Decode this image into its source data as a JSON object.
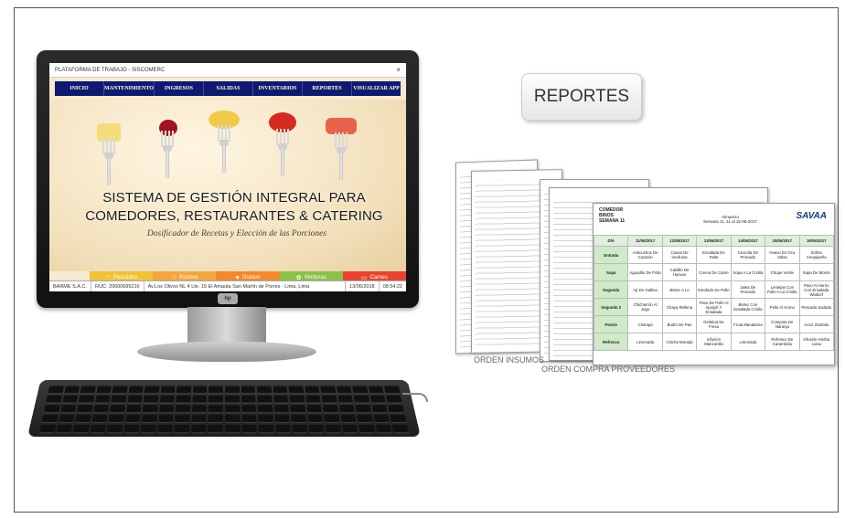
{
  "window": {
    "title": "PLATAFORMA DE TRABAJO - SISCOMERC",
    "close_glyph": "×"
  },
  "menu": [
    "INICIO",
    "MANTENIMIENTO",
    "INGRESOS",
    "SALIDAS",
    "INVENTARIOS",
    "REPORTES",
    "VISUALIZAR APP"
  ],
  "hero": {
    "title_line1": "SISTEMA DE GESTIÓN INTEGRAL PARA",
    "title_line2": "COMEDORES, RESTAURANTES & CATERING",
    "subtitle": "Dosificador de Recetas y Elección de las Porciones"
  },
  "categories": [
    {
      "label": "Pescados",
      "icon": "fish-icon",
      "glyph": "◠",
      "color": "#f0c13a"
    },
    {
      "label": "Postres",
      "icon": "dessert-icon",
      "glyph": "♡",
      "color": "#f2a641"
    },
    {
      "label": "Granos",
      "icon": "grain-icon",
      "glyph": "♥",
      "color": "#f08a2e"
    },
    {
      "label": "Verduras",
      "icon": "vegetable-icon",
      "glyph": "✿",
      "color": "#8cc04a"
    },
    {
      "label": "Carnes",
      "icon": "meat-icon",
      "glyph": "▭",
      "color": "#e8452e"
    }
  ],
  "status": {
    "company": "BARME S.A.C.",
    "ruc": "RUC: 20600695216",
    "address": "Av.Los Olivos NL 4 Lte. 15 El Amauta San Martín de Porres - Lima, Lima",
    "date": "13/06/2018",
    "time": "08:54:22"
  },
  "monitor_logo": "hp",
  "reportes_button": "REPORTES",
  "report_sheet": {
    "brand": "SAVAA",
    "header_left": [
      "COMEDOR",
      "BINOS",
      "SEMANA 11"
    ],
    "header_mid": [
      "Almuerzo",
      "Semana 11, 11 al 15-06-2017"
    ],
    "columns": [
      "DÍA",
      "11/06/2017",
      "12/06/2017",
      "13/06/2017",
      "14/06/2017",
      "15/06/2017",
      "16/06/2017"
    ],
    "rows": [
      {
        "label": "Entrada",
        "cells": [
          "Anticuchos De Corazón",
          "Causa De Verduras",
          "Ensalada De Palta",
          "Cecinita De Pescado",
          "Huevo En Ocu Salsa",
          "Sofrito Arequipeño"
        ]
      },
      {
        "label": "Sopa",
        "cells": [
          "Aguadito De Pollo",
          "Caldillo De Huevos",
          "Crema De Carne",
          "Sopa A La Criolla",
          "Chupe Verde",
          "Sopa De Morón"
        ]
      },
      {
        "label": "Segundo",
        "cells": [
          "Ají De Gallina",
          "Bistec A Lo",
          "Estofado De Pollo",
          "Jalea De Pescado",
          "Lentejas Con Pollo A La Criolla",
          "Pavo Al Horno Con Ensalada Waldorf"
        ]
      },
      {
        "label": "Segundo 2",
        "cells": [
          "Chicharrón Al Jugo",
          "Chaya Rellena",
          "Pavo De Pollo Al Ajonjolí Y Ensalada",
          "Bistec Con Ensalada Criolla",
          "Pollo Al Horno",
          "Pescado Sudado"
        ]
      },
      {
        "label": "Postre",
        "cells": [
          "Champú",
          "Budín De Pan",
          "Gelatina De Fresa",
          "Fruta Mandarina",
          "Compota De Naranja",
          "Arroz Zambito"
        ]
      },
      {
        "label": "Refresco",
        "cells": [
          "Limonada",
          "Chicha Morada",
          "Infusión Manzanilla",
          "Limonada",
          "Refresco De Carambola",
          "Infusión Hierba Luisa"
        ]
      }
    ]
  },
  "captions": {
    "insumos": "ORDEN INSUMOS",
    "proveedores": "ORDEN COMPRA PROVEEDORES"
  }
}
